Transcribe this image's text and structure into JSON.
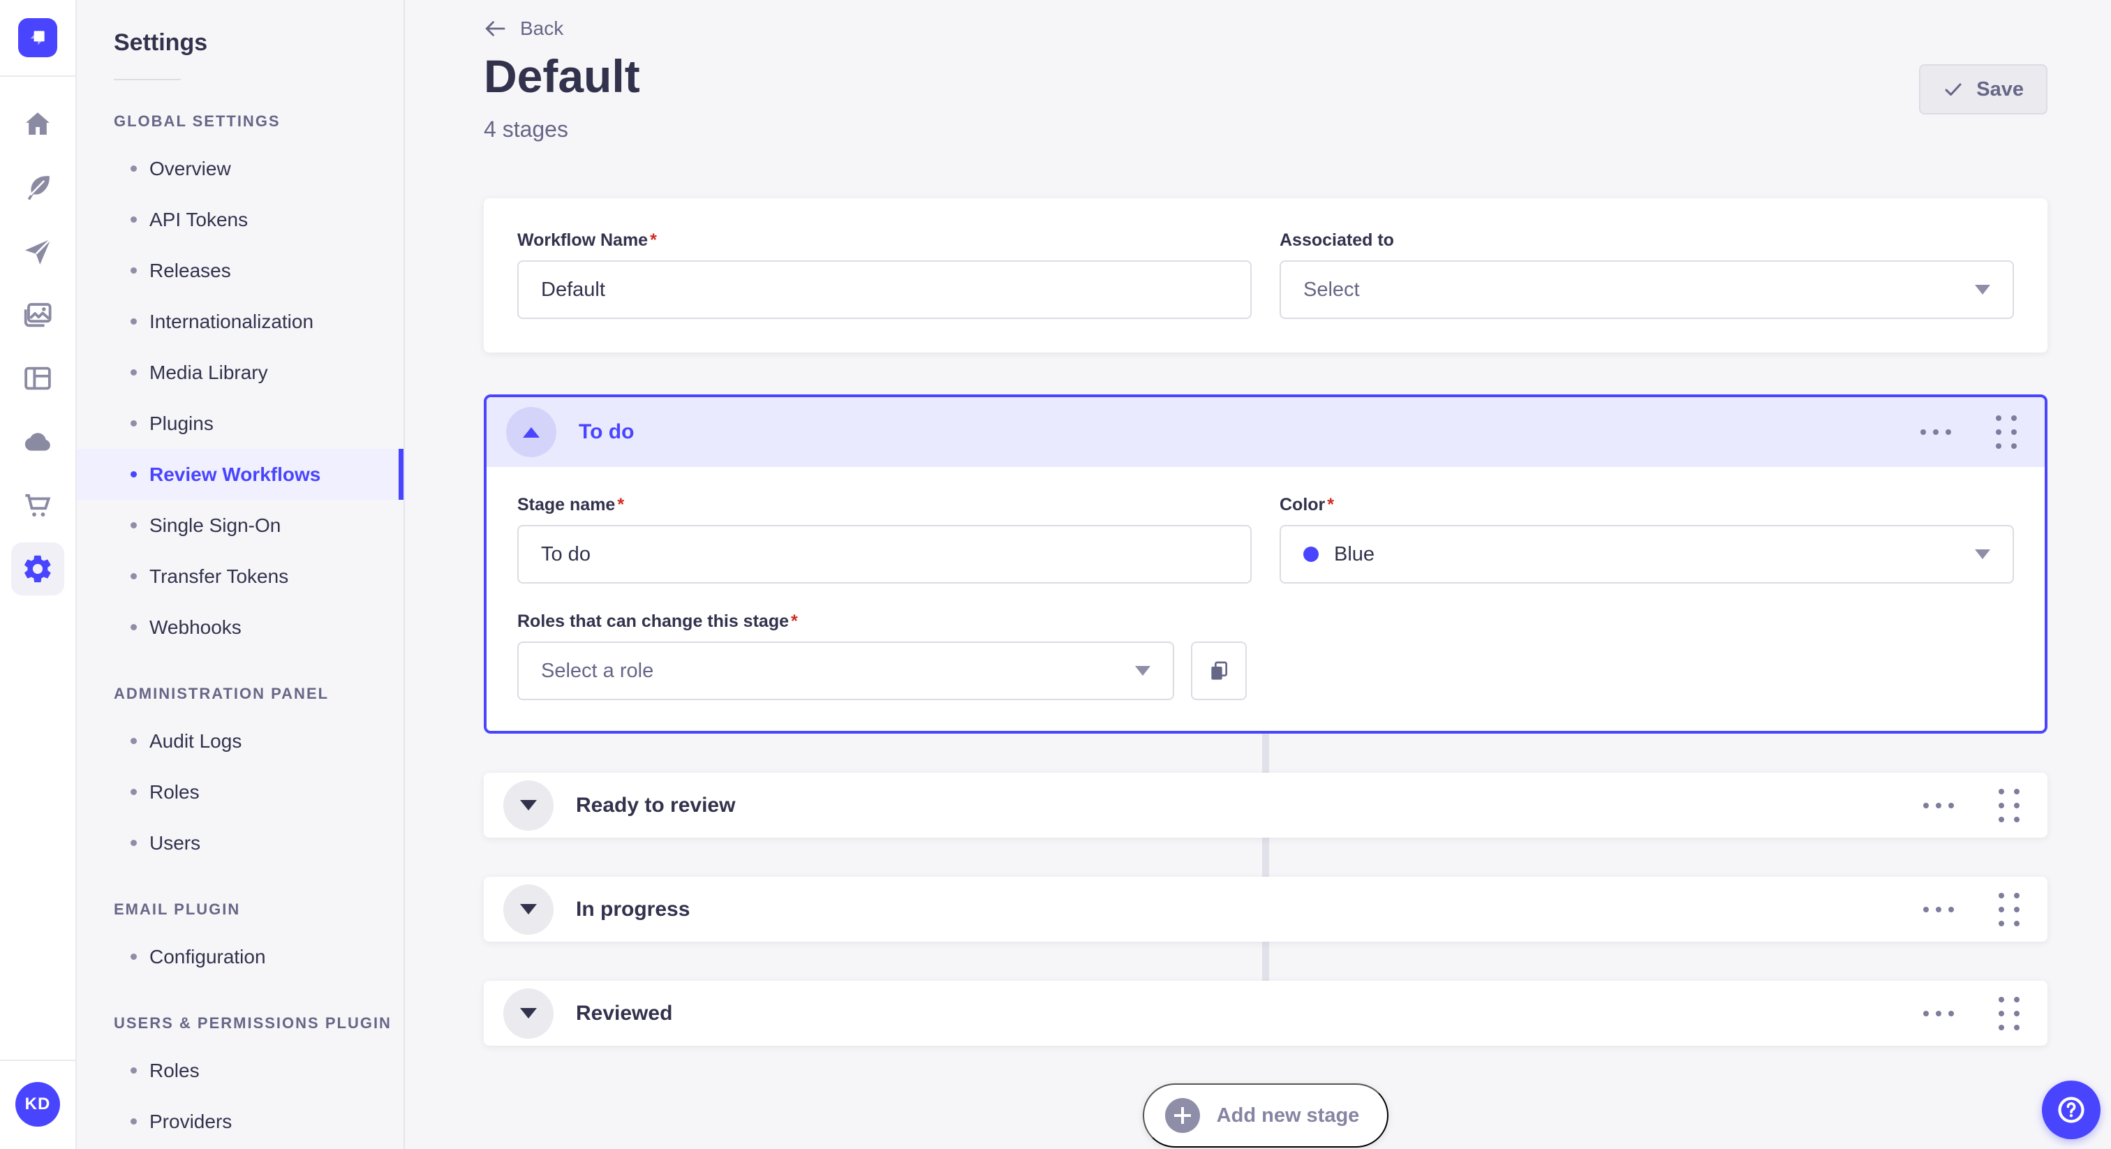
{
  "rail": {
    "logo_icon": "strapi-logo",
    "icons": [
      "home",
      "content-manager",
      "content-type-builder",
      "media-library",
      "marketplace",
      "deploy",
      "purchase",
      "settings"
    ],
    "active_icon": "settings",
    "avatar_initials": "KD"
  },
  "sidebar": {
    "title": "Settings",
    "sections": [
      {
        "label": "GLOBAL SETTINGS",
        "items": [
          {
            "label": "Overview",
            "active": false
          },
          {
            "label": "API Tokens",
            "active": false
          },
          {
            "label": "Releases",
            "active": false
          },
          {
            "label": "Internationalization",
            "active": false
          },
          {
            "label": "Media Library",
            "active": false
          },
          {
            "label": "Plugins",
            "active": false
          },
          {
            "label": "Review Workflows",
            "active": true
          },
          {
            "label": "Single Sign-On",
            "active": false
          },
          {
            "label": "Transfer Tokens",
            "active": false
          },
          {
            "label": "Webhooks",
            "active": false
          }
        ]
      },
      {
        "label": "ADMINISTRATION PANEL",
        "items": [
          {
            "label": "Audit Logs",
            "active": false
          },
          {
            "label": "Roles",
            "active": false
          },
          {
            "label": "Users",
            "active": false
          }
        ]
      },
      {
        "label": "EMAIL PLUGIN",
        "items": [
          {
            "label": "Configuration",
            "active": false
          }
        ]
      },
      {
        "label": "USERS & PERMISSIONS PLUGIN",
        "items": [
          {
            "label": "Roles",
            "active": false
          },
          {
            "label": "Providers",
            "active": false
          }
        ]
      }
    ]
  },
  "header": {
    "back_label": "Back",
    "title": "Default",
    "subtitle": "4 stages",
    "save_label": "Save"
  },
  "ui": {
    "required_marker": "*"
  },
  "workflow_form": {
    "name": {
      "label": "Workflow Name",
      "required": true,
      "value": "Default"
    },
    "associated": {
      "label": "Associated to",
      "required": false,
      "value": "Select"
    }
  },
  "stages": [
    {
      "name": "To do",
      "expanded": true
    },
    {
      "name": "Ready to review",
      "expanded": false
    },
    {
      "name": "In progress",
      "expanded": false
    },
    {
      "name": "Reviewed",
      "expanded": false
    }
  ],
  "stage_form": {
    "stage_name": {
      "label": "Stage name",
      "required": true,
      "value": "To do"
    },
    "color": {
      "label": "Color",
      "required": true,
      "value": "Blue",
      "hex": "#4945ff"
    },
    "roles": {
      "label": "Roles that can change this stage",
      "required": true,
      "placeholder": "Select a role"
    }
  },
  "add_stage": {
    "label": "Add new stage"
  },
  "colors": {
    "primary": "#4945ff",
    "primary_light": "#f0f0ff",
    "accordion_header": "#eaeafe",
    "text": "#32324d",
    "muted": "#666687",
    "border": "#dcdce4",
    "required_red": "#d02b20",
    "page_background": "#f6f6f9"
  }
}
